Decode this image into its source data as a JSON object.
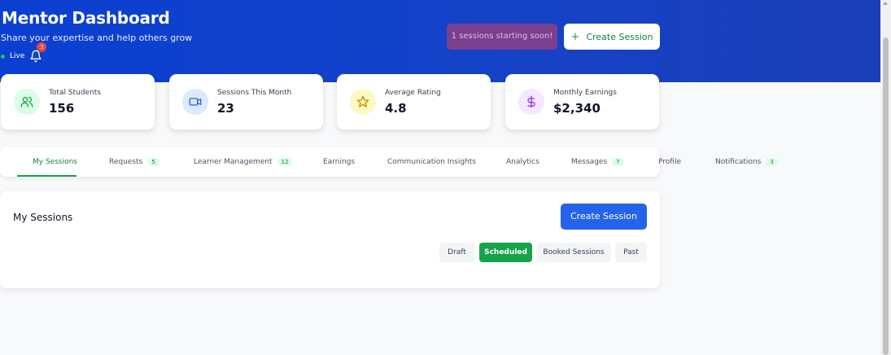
{
  "header": {
    "title": "Mentor Dashboard",
    "subtitle": "Share your expertise and help others grow",
    "live_label": "Live",
    "bell_count": "3",
    "alert_pill": "1 sessions starting soon!",
    "create_button_label": "Create Session"
  },
  "stats": [
    {
      "label": "Total Students",
      "value": "156",
      "icon": "users-icon",
      "color": "#16a34a",
      "bg": "#dcfce7"
    },
    {
      "label": "Sessions This Month",
      "value": "23",
      "icon": "video-icon",
      "color": "#2563eb",
      "bg": "#dbeafe"
    },
    {
      "label": "Average Rating",
      "value": "4.8",
      "icon": "star-icon",
      "color": "#ca8a04",
      "bg": "#fef9c3"
    },
    {
      "label": "Monthly Earnings",
      "value": "$2,340",
      "icon": "dollar-icon",
      "color": "#9333ea",
      "bg": "#f3e8ff"
    }
  ],
  "tabs": [
    {
      "label": "My Sessions",
      "count": ""
    },
    {
      "label": "Requests",
      "count": "5"
    },
    {
      "label": "Learner Management",
      "count": "12"
    },
    {
      "label": "Earnings",
      "count": ""
    },
    {
      "label": "Communication Insights",
      "count": ""
    },
    {
      "label": "Analytics",
      "count": ""
    },
    {
      "label": "Messages",
      "count": "7"
    },
    {
      "label": "Profile",
      "count": ""
    },
    {
      "label": "Notifications",
      "count": "3"
    }
  ],
  "sessions_panel": {
    "title": "My Sessions",
    "create_button_label": "Create Session",
    "filters": [
      "Draft",
      "Scheduled",
      "Booked Sessions",
      "Past"
    ],
    "active_filter": "Scheduled"
  },
  "colors": {
    "hero_gradient_start": "#0a3fd1",
    "hero_gradient_end": "#1c3fb8",
    "accent_green": "#16a34a",
    "primary_blue": "#2563eb"
  }
}
